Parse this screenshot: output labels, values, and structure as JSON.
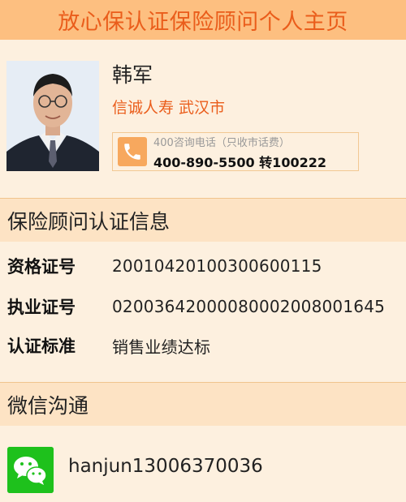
{
  "header": {
    "title": "放心保认证保险顾问个人主页"
  },
  "profile": {
    "name": "韩军",
    "company": "信诚人寿 武汉市",
    "phone_label": "400咨询电话（只收市话费）",
    "phone_number": "400-890-5500 转100222"
  },
  "certification": {
    "title": "保险顾问认证信息",
    "rows": [
      {
        "label": "资格证号",
        "value": "20010420100300600115"
      },
      {
        "label": "执业证号",
        "value": "02003642000080002008001645"
      },
      {
        "label": "认证标准",
        "value": "销售业绩达标"
      }
    ]
  },
  "wechat": {
    "title": "微信沟通",
    "id": "hanjun13006370036"
  },
  "icons": {
    "phone": "phone-icon",
    "wechat": "wechat-icon",
    "avatar": "avatar-photo"
  },
  "colors": {
    "header_bg": "#fdbf80",
    "accent": "#ea5d1b",
    "section_bg": "#fde3c4",
    "page_bg": "#fdf0df",
    "wechat_green": "#1ec11c"
  }
}
